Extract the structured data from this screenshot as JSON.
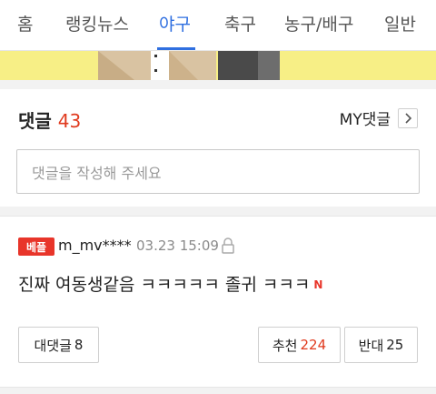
{
  "tabs": {
    "home": "홈",
    "ranking_news": "랭킹뉴스",
    "baseball": "야구",
    "soccer": "축구",
    "basketball_volleyball": "농구/배구",
    "general": "일반",
    "active": "야구",
    "accent_color": "#2f6fe0"
  },
  "banner": {
    "background": "#f7ef86"
  },
  "comments": {
    "title": "댓글",
    "count": "43",
    "my_comments_label": "MY댓글",
    "input_placeholder": "댓글을 작성해 주세요"
  },
  "comment": {
    "badge": "베플",
    "author": "m_mv****",
    "timestamp": "03.23 15:09",
    "body": "진짜 여동생같음 ㅋㅋㅋㅋㅋ 졸귀 ㅋㅋㅋ",
    "new_badge": "N",
    "reply_label": "대댓글",
    "reply_count": "8",
    "like_label": "추천",
    "like_count": "224",
    "dislike_label": "반대",
    "dislike_count": "25"
  }
}
